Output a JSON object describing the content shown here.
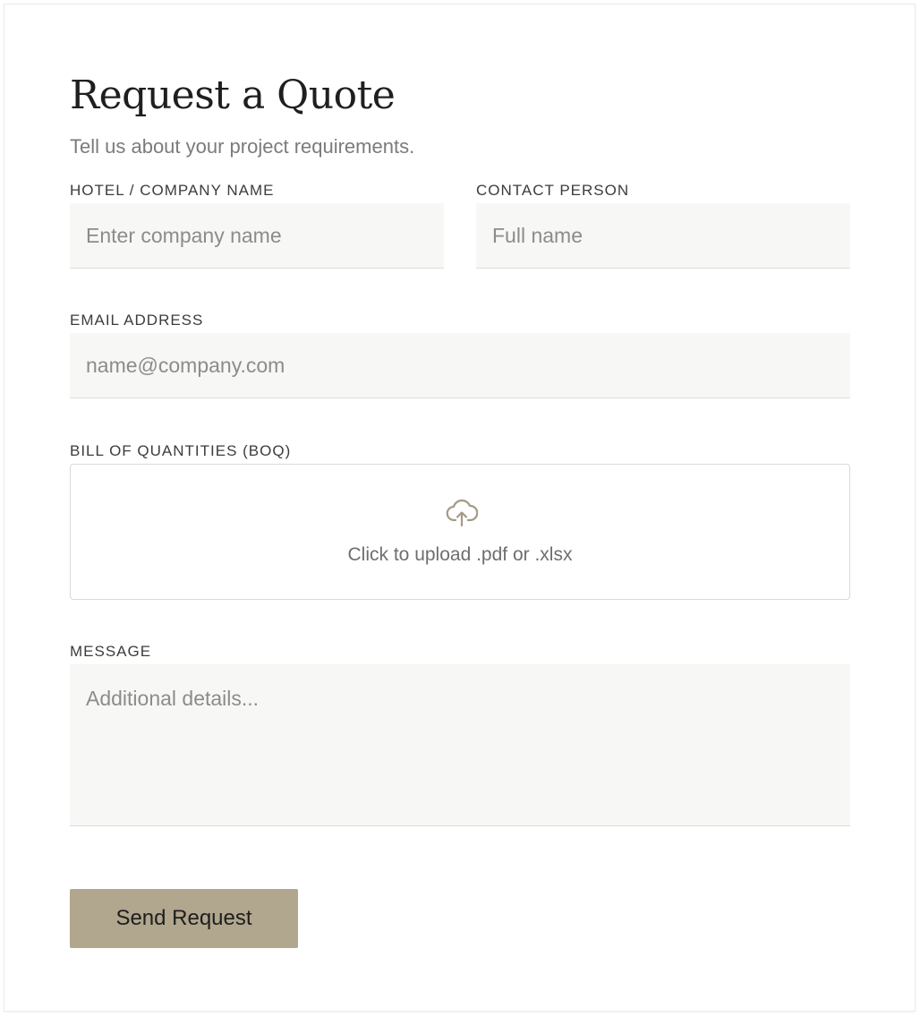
{
  "form": {
    "title": "Request a Quote",
    "subtitle": "Tell us about your project requirements.",
    "company": {
      "label": "HOTEL / COMPANY NAME",
      "placeholder": "Enter company name",
      "value": ""
    },
    "contact": {
      "label": "CONTACT PERSON",
      "placeholder": "Full name",
      "value": ""
    },
    "email": {
      "label": "EMAIL ADDRESS",
      "placeholder": "name@company.com",
      "value": ""
    },
    "boq": {
      "label": "BILL OF QUANTITIES (BOQ)",
      "upload_text": "Click to upload .pdf or .xlsx",
      "icon": "cloud-upload-icon"
    },
    "message": {
      "label": "MESSAGE",
      "placeholder": "Additional details...",
      "value": ""
    },
    "submit_label": "Send Request"
  },
  "colors": {
    "accent": "#b1a68e",
    "field_background": "#f7f7f5",
    "icon": "#a39a84"
  }
}
